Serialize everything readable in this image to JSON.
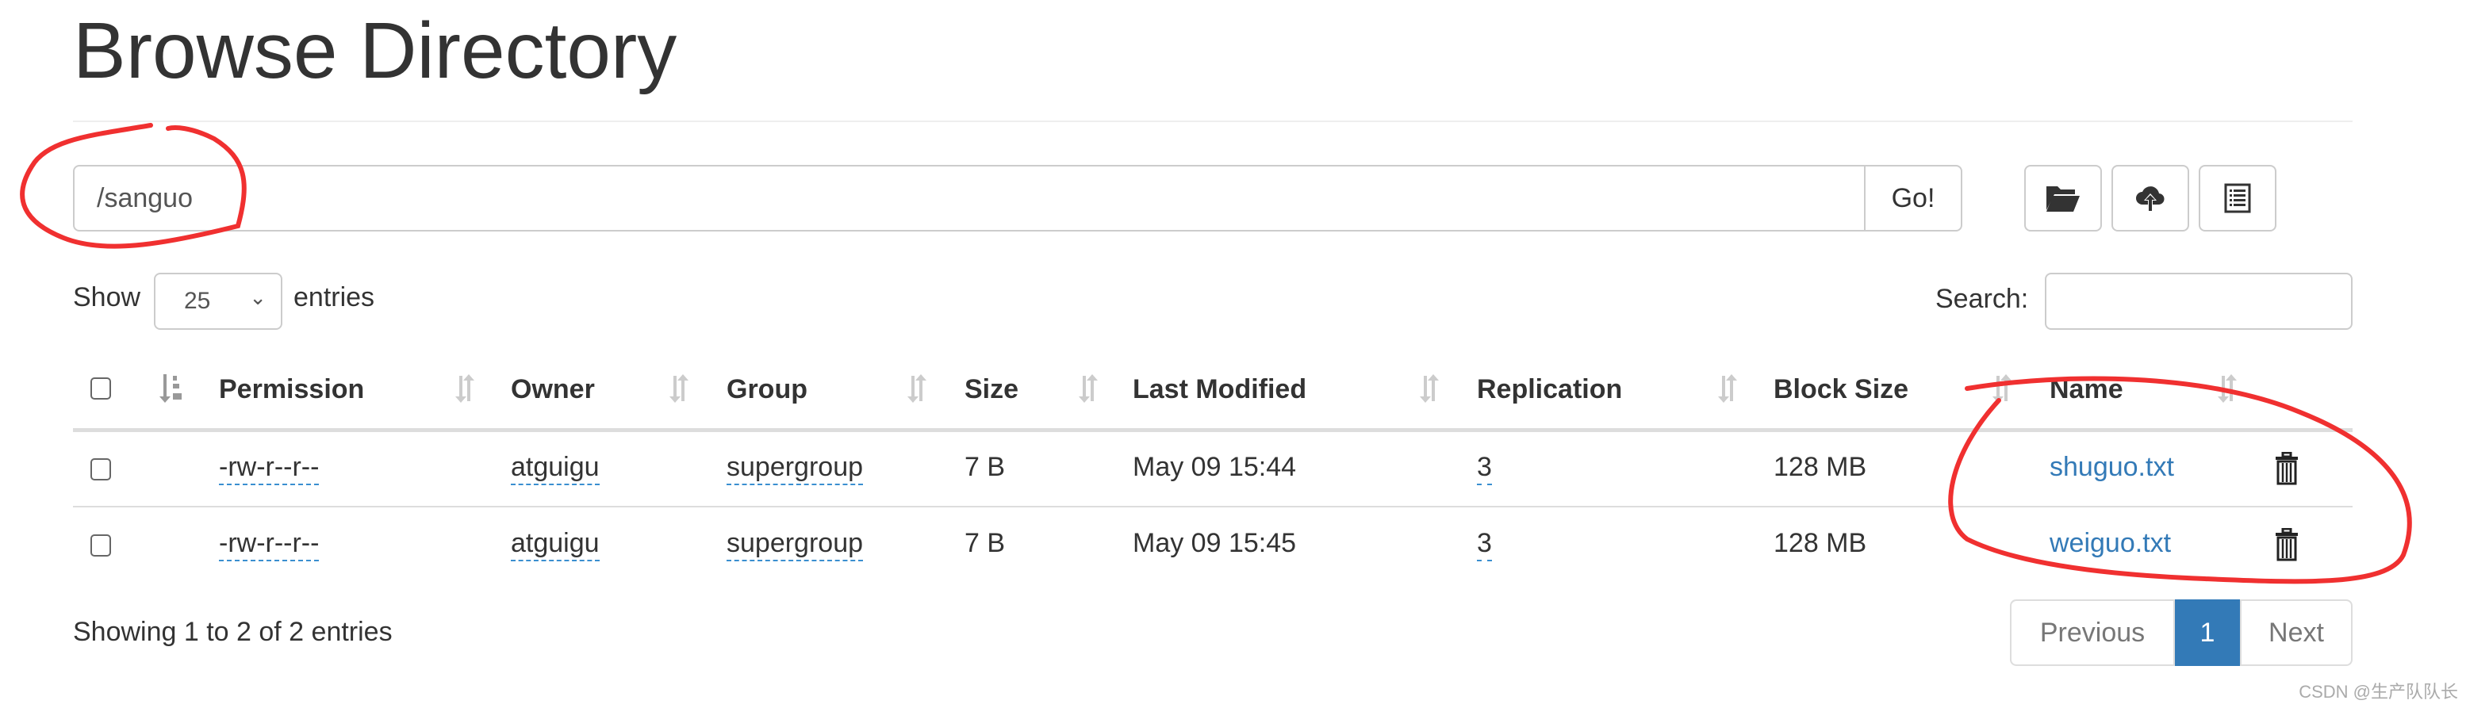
{
  "page": {
    "title": "Browse Directory"
  },
  "path_bar": {
    "value": "/sanguo",
    "go_label": "Go!"
  },
  "toolbar": [
    {
      "icon": "folder-open-icon"
    },
    {
      "icon": "cloud-upload-icon"
    },
    {
      "icon": "list-alt-icon"
    }
  ],
  "table_controls": {
    "show_label": "Show",
    "entries_label": "entries",
    "page_size": "25",
    "search_label": "Search:",
    "search_value": ""
  },
  "table": {
    "columns": [
      "Permission",
      "Owner",
      "Group",
      "Size",
      "Last Modified",
      "Replication",
      "Block Size",
      "Name"
    ],
    "rows": [
      {
        "permission": "-rw-r--r--",
        "owner": "atguigu",
        "group": "supergroup",
        "size": "7 B",
        "last_modified": "May 09 15:44",
        "replication": "3",
        "block_size": "128 MB",
        "name": "shuguo.txt"
      },
      {
        "permission": "-rw-r--r--",
        "owner": "atguigu",
        "group": "supergroup",
        "size": "7 B",
        "last_modified": "May 09 15:45",
        "replication": "3",
        "block_size": "128 MB",
        "name": "weiguo.txt"
      }
    ]
  },
  "footer": {
    "info": "Showing 1 to 2 of 2 entries",
    "previous": "Previous",
    "current_page": "1",
    "next": "Next"
  },
  "watermark": "CSDN @生产队队长",
  "colors": {
    "link": "#337ab7",
    "active_page": "#337ab7",
    "annotation": "#f03030"
  }
}
